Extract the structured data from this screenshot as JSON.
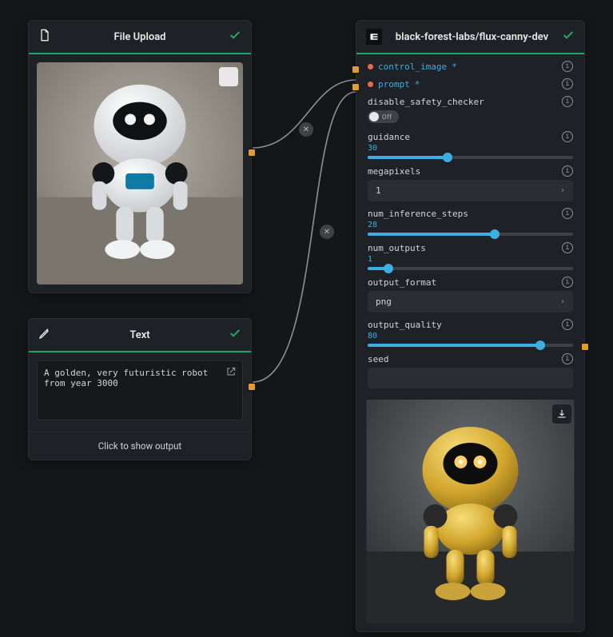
{
  "nodes": {
    "file_upload": {
      "title": "File Upload"
    },
    "text": {
      "title": "Text",
      "value": "A golden, very futuristic robot from year 3000",
      "footer": "Click to show output"
    },
    "flux": {
      "title": "black-forest-labs/flux-canny-dev",
      "params": {
        "control_image": {
          "label": "control_image",
          "required": true
        },
        "prompt": {
          "label": "prompt",
          "required": true
        },
        "disable_safety_checker": {
          "label": "disable_safety_checker",
          "state": "Off"
        },
        "guidance": {
          "label": "guidance",
          "value": 30,
          "min": 0,
          "max": 100,
          "fill_pct": 39
        },
        "megapixels": {
          "label": "megapixels",
          "value": "1"
        },
        "num_inference_steps": {
          "label": "num_inference_steps",
          "value": 28,
          "min": 0,
          "max": 50,
          "fill_pct": 62
        },
        "num_outputs": {
          "label": "num_outputs",
          "value": 1,
          "min": 1,
          "max": 20,
          "fill_pct": 10
        },
        "output_format": {
          "label": "output_format",
          "value": "png"
        },
        "output_quality": {
          "label": "output_quality",
          "value": 80,
          "min": 0,
          "max": 100,
          "fill_pct": 84
        },
        "seed": {
          "label": "seed",
          "value": ""
        }
      }
    }
  },
  "required_star": "*",
  "icons": {
    "file": "file-icon",
    "pencil": "pencil-icon",
    "check": "check-icon",
    "download": "download-icon",
    "info": "info-icon",
    "external": "external-icon",
    "close": "close-icon",
    "replicate": "replicate-logo-icon"
  },
  "colors": {
    "accent": "#1fa667",
    "link": "#3daee0",
    "port": "#e69a28",
    "req_dot": "#e66a4b"
  }
}
